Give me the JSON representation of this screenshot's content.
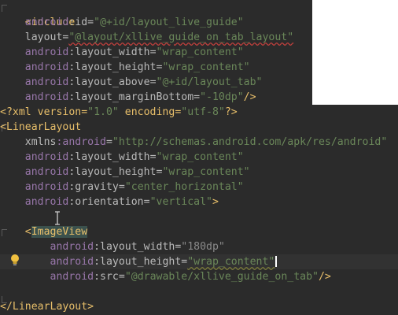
{
  "editor": {
    "colors": {
      "background": "#2b2b2b",
      "tag": "#e8bf6a",
      "attribute": "#9876aa",
      "value": "#6a8759",
      "text": "#bababa"
    },
    "icons": [
      "intention-bulb-icon",
      "text-cursor-icon",
      "fold-marker-icon"
    ],
    "lines": {
      "l1_tag": "<include",
      "l2_attr": "android",
      "l2_rest": ":id",
      "l2_val": "\"@+id/layout_live_guide\"",
      "l3_attr": "layout",
      "l3_val": "\"@layout/xllive_guide_on_tab_layout\"",
      "l4_attr": "android",
      "l4_rest": ":layout_width",
      "l4_val": "\"wrap_content\"",
      "l5_attr": "android",
      "l5_rest": ":layout_height",
      "l5_val": "\"wrap_content\"",
      "l6_attr": "android",
      "l6_rest": ":layout_above",
      "l6_val": "\"@+id/layout_tab\"",
      "l7_attr": "android",
      "l7_rest": ":layout_marginBottom",
      "l7_val": "\"-10dp\"",
      "l7_end": "/>",
      "l8_start": "<?xml version=",
      "l8_v1": "\"1.0\"",
      "l8_mid": " encoding=",
      "l8_v2": "\"utf-8\"",
      "l8_end": "?>",
      "l9_tag": "<LinearLayout",
      "l10_attr": "xmlns",
      "l10_rest": ":android",
      "l10_val": "\"http://schemas.android.com/apk/res/android\"",
      "l11_attr": "android",
      "l11_rest": ":layout_width",
      "l11_val": "\"wrap_content\"",
      "l12_attr": "android",
      "l12_rest": ":layout_height",
      "l12_val": "\"wrap_content\"",
      "l13_attr": "android",
      "l13_rest": ":gravity",
      "l13_val": "\"center_horizontal\"",
      "l14_attr": "android",
      "l14_rest": ":orientation",
      "l14_val": "\"vertical\"",
      "l14_end": ">",
      "l16_open": "<",
      "l16_tag": "ImageView",
      "l17_attr": "android",
      "l17_rest": ":layout_width",
      "l17_val": "\"180dp\"",
      "l18_attr": "android",
      "l18_rest": ":layout_height",
      "l18_val": "\"wrap_content\"",
      "l19_attr": "android",
      "l19_rest": ":src",
      "l19_val": "\"@drawable/xllive_guide_on_tab\"",
      "l19_end": "/>",
      "l21_tag": "</LinearLayout>"
    }
  }
}
